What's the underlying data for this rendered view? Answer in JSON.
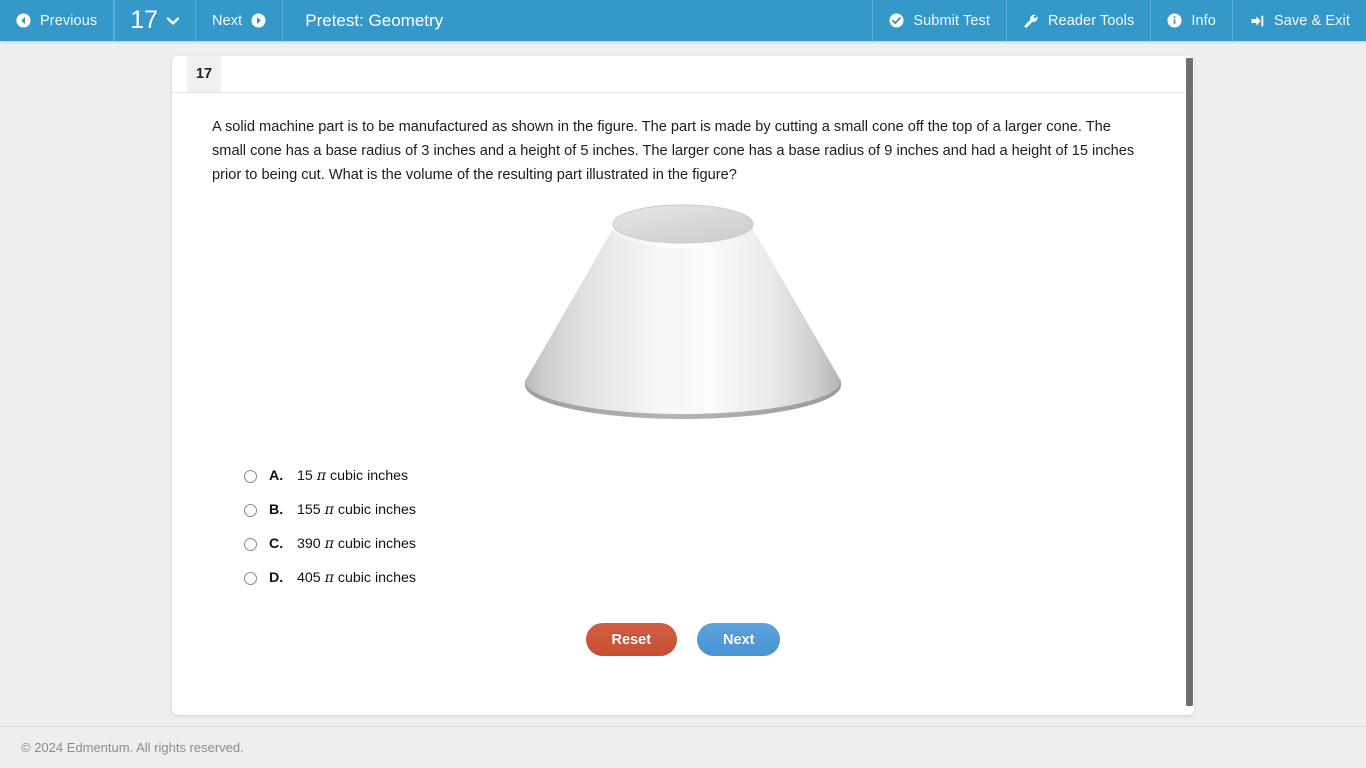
{
  "header": {
    "previous_label": "Previous",
    "question_number": "17",
    "next_label": "Next",
    "title": "Pretest: Geometry",
    "submit_label": "Submit Test",
    "reader_tools_label": "Reader Tools",
    "info_label": "Info",
    "save_exit_label": "Save & Exit",
    "bar_color": "#3498c8"
  },
  "question": {
    "number": "17",
    "text": "A solid machine part is to be manufactured as shown in the figure. The part is made by cutting a small cone off the top of a larger cone. The small cone has a base radius of 3 inches and a height of 5 inches. The larger cone has a base radius of 9 inches and had a height of 15 inches prior to being cut. What is the volume of the resulting part illustrated in the figure?",
    "figure_alt": "truncated-cone-frustum-figure"
  },
  "options": [
    {
      "letter": "A.",
      "value": "15",
      "unit": "cubic inches",
      "selected": false
    },
    {
      "letter": "B.",
      "value": "155",
      "unit": "cubic inches",
      "selected": false
    },
    {
      "letter": "C.",
      "value": "390",
      "unit": "cubic inches",
      "selected": false
    },
    {
      "letter": "D.",
      "value": "405",
      "unit": "cubic inches",
      "selected": false
    }
  ],
  "actions": {
    "reset_label": "Reset",
    "reset_color": "#c9542f",
    "next_label": "Next",
    "next_color": "#4a93d2"
  },
  "footer": {
    "copyright": "© 2024 Edmentum. All rights reserved."
  }
}
